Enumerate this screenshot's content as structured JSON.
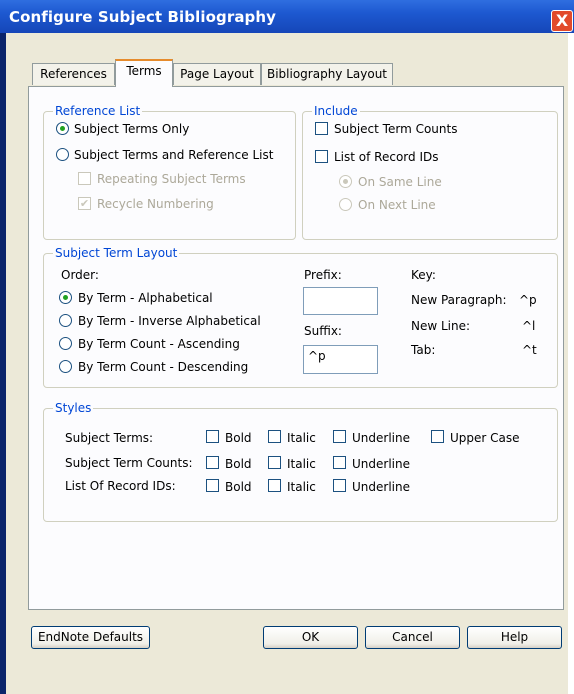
{
  "window": {
    "title": "Configure Subject Bibliography",
    "close_label": "X"
  },
  "tabs": [
    {
      "label": "References"
    },
    {
      "label": "Terms",
      "active": true
    },
    {
      "label": "Page Layout"
    },
    {
      "label": "Bibliography Layout"
    }
  ],
  "reference_list": {
    "legend": "Reference List",
    "subject_terms_only": "Subject Terms Only",
    "subject_terms_and_reference_list": "Subject Terms and Reference List",
    "repeating_subject_terms": "Repeating Subject Terms",
    "recycle_numbering": "Recycle Numbering"
  },
  "include": {
    "legend": "Include",
    "subject_term_counts": "Subject Term Counts",
    "list_of_record_ids": "List of Record IDs",
    "on_same_line": "On Same Line",
    "on_next_line": "On Next Line"
  },
  "subject_term_layout": {
    "legend": "Subject Term Layout",
    "order_label": "Order:",
    "orders": [
      "By Term - Alphabetical",
      "By Term - Inverse Alphabetical",
      "By Term Count - Ascending",
      "By Term Count - Descending"
    ],
    "prefix_label": "Prefix:",
    "prefix_value": "",
    "suffix_label": "Suffix:",
    "suffix_value": "^p",
    "key_label": "Key:",
    "keys": [
      {
        "name": "New Paragraph:",
        "code": "^p"
      },
      {
        "name": "New Line:",
        "code": "^l"
      },
      {
        "name": "Tab:",
        "code": "^t"
      }
    ]
  },
  "styles": {
    "legend": "Styles",
    "rows": [
      {
        "label": "Subject Terms:",
        "bold": "Bold",
        "italic": "Italic",
        "underline": "Underline",
        "upper": "Upper Case"
      },
      {
        "label": "Subject Term Counts:",
        "bold": "Bold",
        "italic": "Italic",
        "underline": "Underline"
      },
      {
        "label": "List Of Record IDs:",
        "bold": "Bold",
        "italic": "Italic",
        "underline": "Underline"
      }
    ]
  },
  "buttons": {
    "defaults": "EndNote Defaults",
    "ok": "OK",
    "cancel": "Cancel",
    "help": "Help"
  },
  "colors": {
    "titlebar": "#1d58d0",
    "dialog_bg": "#ece9d8",
    "legend_text": "#0046d5",
    "active_tab_accent": "#e68b2c",
    "radio_dot": "#21a121"
  }
}
